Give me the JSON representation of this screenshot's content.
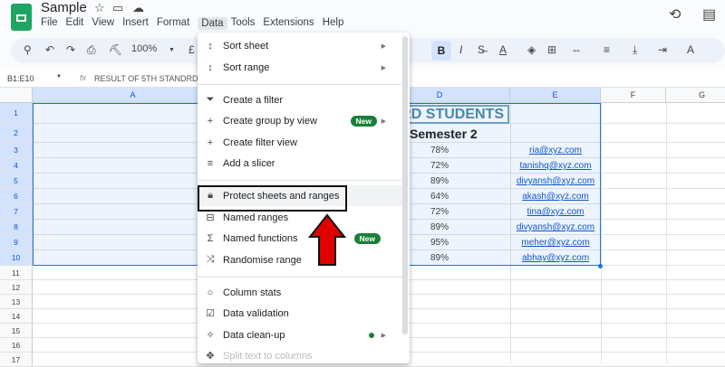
{
  "app": {
    "title": "Sample",
    "menus": [
      "File",
      "Edit",
      "View",
      "Insert",
      "Format",
      "Data",
      "Tools",
      "Extensions",
      "Help"
    ],
    "active_menu": "Data"
  },
  "toolbar": {
    "zoom": "100%",
    "bold": "B",
    "italic": "I",
    "currency": "£"
  },
  "formula_bar": {
    "name_box": "B1:E10",
    "fx": "fx",
    "content": "RESULT OF 5TH STANDRD ST"
  },
  "columns": [
    "A",
    "D",
    "E",
    "F",
    "G"
  ],
  "rows": [
    "1",
    "2",
    "3",
    "4",
    "5",
    "6",
    "7",
    "8",
    "9",
    "10",
    "11",
    "12",
    "13",
    "14",
    "15",
    "16",
    "17"
  ],
  "sheet": {
    "title_fragment": "RD STUDENTS",
    "subheader": "Semester 2",
    "scores": [
      "78%",
      "72%",
      "89%",
      "64%",
      "72%",
      "89%",
      "95%",
      "89%"
    ],
    "emails": [
      "ria@xyz.com",
      "tanishq@xyz.com",
      "divyansh@xyz.com",
      "akash@xyz.com",
      "tina@xyz.com",
      "divyansh@xyz.com",
      "meher@xyz.com",
      "abhay@xyz.com"
    ]
  },
  "data_menu": {
    "items": [
      {
        "label": "Sort sheet",
        "icon": "sort-icon",
        "submenu": true
      },
      {
        "label": "Sort range",
        "icon": "sort-icon",
        "submenu": true
      },
      {
        "label": "Create a filter",
        "icon": "filter-icon"
      },
      {
        "label": "Create group by view",
        "icon": "plus-icon",
        "badge": "New",
        "submenu": true
      },
      {
        "label": "Create filter view",
        "icon": "plus-icon"
      },
      {
        "label": "Add a slicer",
        "icon": "slicer-icon"
      },
      {
        "label": "Protect sheets and ranges",
        "icon": "lock-icon",
        "highlighted": true
      },
      {
        "label": "Named ranges",
        "icon": "named-ranges-icon"
      },
      {
        "label": "Named functions",
        "icon": "sigma-icon",
        "badge": "New"
      },
      {
        "label": "Randomise range",
        "icon": "shuffle-icon"
      },
      {
        "label": "Column stats",
        "icon": "bulb-icon"
      },
      {
        "label": "Data validation",
        "icon": "validation-icon"
      },
      {
        "label": "Data clean-up",
        "icon": "wand-icon",
        "submenu": true
      },
      {
        "label": "Split text to columns",
        "icon": "split-icon",
        "disabled": true
      }
    ]
  },
  "colors": {
    "accent": "#1a73e8",
    "badge": "#188038",
    "annotation_arrow": "#e00000",
    "title_text": "#4a86a8"
  }
}
